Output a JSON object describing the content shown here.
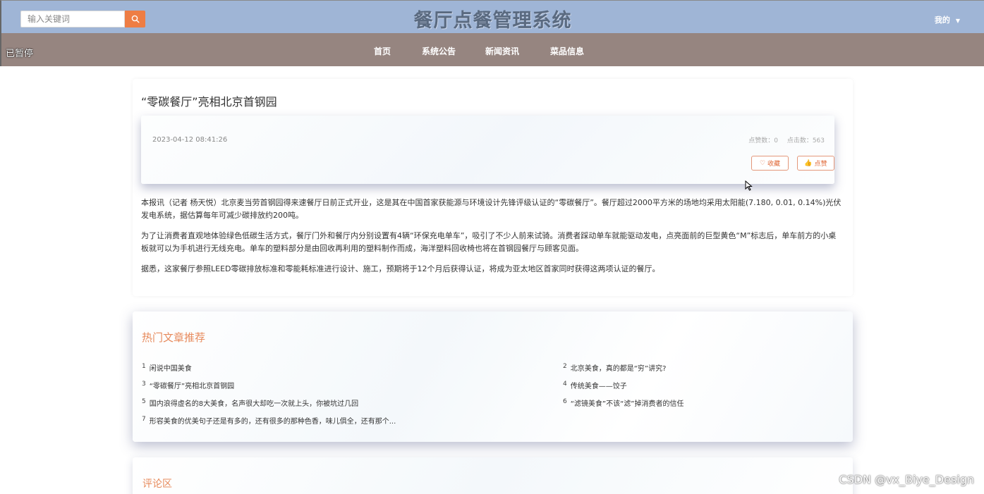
{
  "header": {
    "search_placeholder": "输入关键词",
    "site_title": "餐厅点餐管理系统",
    "user_menu": "我的"
  },
  "nav": {
    "status": "已暂停",
    "items": [
      "首页",
      "系统公告",
      "新闻资讯",
      "菜品信息"
    ]
  },
  "article": {
    "title": "“零碳餐厅”亮相北京首钢园",
    "date": "2023-04-12 08:41:26",
    "likes_label": "点赞数：0",
    "clicks_label": "点击数：563",
    "favorite_label": "收藏",
    "like_label": "点赞",
    "paragraphs": [
      "本报讯（记者 杨天悦）北京麦当劳首钢园得来速餐厅日前正式开业，这是其在中国首家获能源与环境设计先锋评级认证的“零碳餐厅”。餐厅超过2000平方米的场地均采用太阳能(7.180, 0.01, 0.14%)光伏发电系统，据估算每年可减少碳排放约200吨。",
      "为了让消费者直观地体验绿色低碳生活方式，餐厅门外和餐厅内分别设置有4辆“环保充电单车”，吸引了不少人前来试骑。消费者踩动单车就能驱动发电，点亮面前的巨型黄色“M”标志后，单车前方的小桌板就可以为手机进行无线充电。单车的塑料部分是由回收再利用的塑料制作而成，海洋塑料回收椅也将在首钢园餐厅与顾客见面。",
      "据悉，这家餐厅参照LEED零碳排放标准和零能耗标准进行设计、施工，预期将于12个月后获得认证，将成为亚太地区首家同时获得这两项认证的餐厅。"
    ]
  },
  "hot": {
    "title": "热门文章推荐",
    "items": [
      {
        "num": "1",
        "text": "闲说中国美食"
      },
      {
        "num": "2",
        "text": "北京美食，真的都是“穷”讲究?"
      },
      {
        "num": "3",
        "text": "“零碳餐厅”亮相北京首钢园"
      },
      {
        "num": "4",
        "text": "传统美食——饺子"
      },
      {
        "num": "5",
        "text": "国内浪得虚名的8大美食，名声很大却吃一次就上头，你被坑过几回"
      },
      {
        "num": "6",
        "text": "“滤镜美食”不该“滤”掉消费者的信任"
      },
      {
        "num": "7",
        "text": "形容美食的优美句子还是有多的，还有很多的那种色香，味儿俱全，还有那个..."
      }
    ]
  },
  "comments": {
    "title": "评论区"
  },
  "watermark": "CSDN @vx_Biye_Design"
}
